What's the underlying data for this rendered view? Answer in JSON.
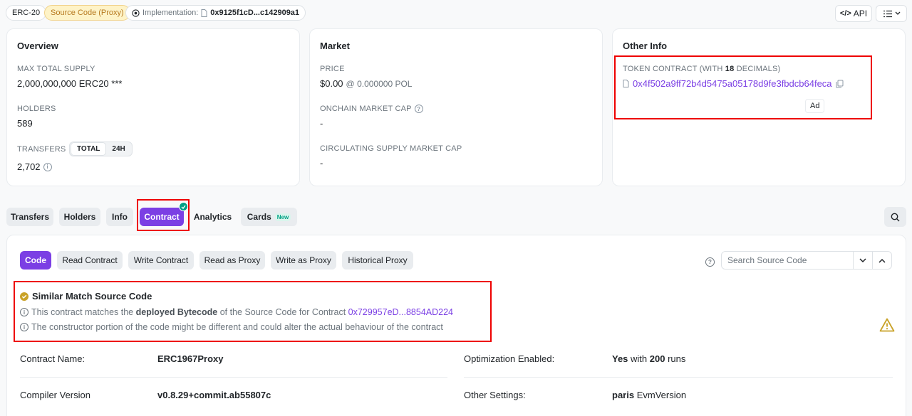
{
  "header": {
    "standard_badge": "ERC-20",
    "source_badge": "Source Code (Proxy)",
    "implementation_label": "Implementation:",
    "implementation_address": "0x9125f1cD...c142909a1",
    "api_label": "API"
  },
  "overview": {
    "title": "Overview",
    "max_supply_label": "MAX TOTAL SUPPLY",
    "max_supply_value": "2,000,000,000 ERC20 ***",
    "holders_label": "HOLDERS",
    "holders_value": "589",
    "transfers_label": "TRANSFERS",
    "transfers_toggle": [
      "TOTAL",
      "24H"
    ],
    "transfers_value": "2,702"
  },
  "market": {
    "title": "Market",
    "price_label": "PRICE",
    "price_value": "$0.00",
    "price_secondary": "@ 0.000000 POL",
    "onchain_cap_label": "ONCHAIN MARKET CAP",
    "onchain_cap_value": "-",
    "circ_cap_label": "CIRCULATING SUPPLY MARKET CAP",
    "circ_cap_value": "-"
  },
  "other_info": {
    "title": "Other Info",
    "token_contract_label_pre": "TOKEN CONTRACT (WITH ",
    "token_contract_decimals": "18",
    "token_contract_label_post": " DECIMALS)",
    "token_contract_address": "0x4f502a9ff72b4d5475a05178d9fe3fbdcb64feca",
    "ad_label": "Ad"
  },
  "tabs": [
    {
      "label": "Transfers"
    },
    {
      "label": "Holders"
    },
    {
      "label": "Info"
    },
    {
      "label": "Contract"
    },
    {
      "label": "Analytics"
    },
    {
      "label": "Cards",
      "badge": "New"
    }
  ],
  "contract": {
    "subtabs": [
      "Code",
      "Read Contract",
      "Write Contract",
      "Read as Proxy",
      "Write as Proxy",
      "Historical Proxy"
    ],
    "search_placeholder": "Search Source Code",
    "match_title": "Similar Match Source Code",
    "match_line1_pre": "This contract matches the ",
    "match_line1_bold": "deployed Bytecode",
    "match_line1_mid": " of the Source Code for Contract ",
    "match_line1_link": "0x729957eD...8854AD224",
    "match_line2": "The constructor portion of the code might be different and could alter the actual behaviour of the contract",
    "name_label": "Contract Name:",
    "name_value": "ERC1967Proxy",
    "optimization_label": "Optimization Enabled:",
    "optimization_yes": "Yes",
    "optimization_with": " with ",
    "optimization_runs_num": "200",
    "optimization_runs": " runs",
    "compiler_label": "Compiler Version",
    "compiler_value": "v0.8.29+commit.ab55807c",
    "settings_label": "Other Settings:",
    "settings_bold": "paris",
    "settings_rest": " EvmVersion"
  },
  "colors": {
    "accent": "#7b3fe4",
    "badge_gold": "#b7791f",
    "highlight": "#e00000",
    "warning": "#c9a227"
  }
}
